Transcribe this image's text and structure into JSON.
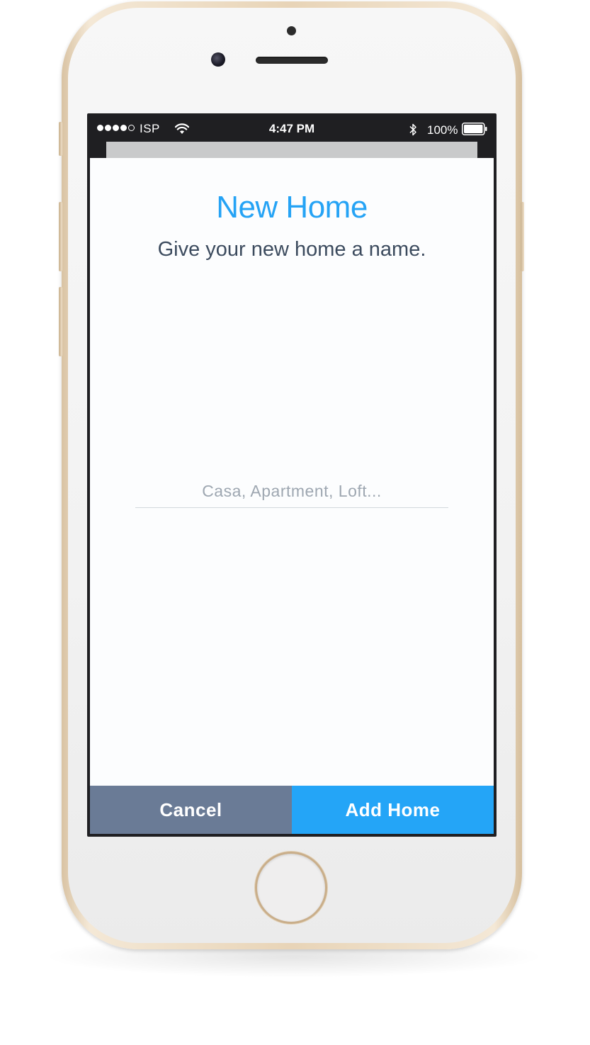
{
  "status_bar": {
    "carrier": "ISP",
    "time": "4:47 PM",
    "battery_percent": "100%",
    "signal_bars_filled": 4,
    "signal_bars_total": 5,
    "icons": [
      "signal-dots-icon",
      "wifi-icon",
      "bluetooth-icon",
      "battery-icon"
    ]
  },
  "dialog": {
    "title": "New Home",
    "subtitle": "Give your new home a name.",
    "name_input": {
      "value": "",
      "placeholder": "Casa, Apartment, Loft..."
    }
  },
  "actions": {
    "cancel_label": "Cancel",
    "add_label": "Add Home"
  },
  "colors": {
    "accent": "#25a3f5",
    "add_button": "#24a5f7",
    "cancel_button": "#6a7b96",
    "subtitle_text": "#3c4b5e",
    "placeholder_text": "#9ea7b1",
    "status_bar_bg": "#1f1f22",
    "phone_frame": "#e8d4b7"
  }
}
